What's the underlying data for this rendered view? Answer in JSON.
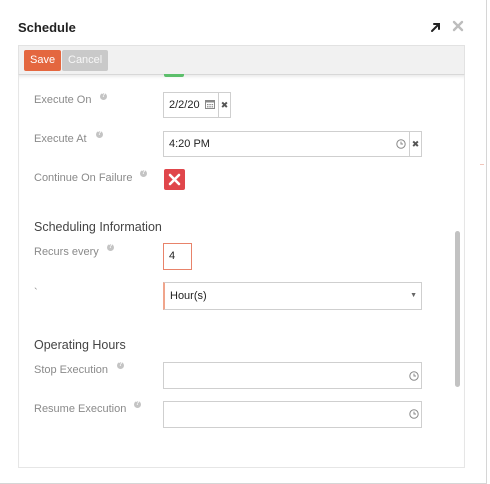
{
  "dialog": {
    "title": "Schedule",
    "expand_icon": "expand-arrow-icon",
    "close_icon": "close-icon"
  },
  "toolbar": {
    "save_label": "Save",
    "cancel_label": "Cancel",
    "save_color": "#e4673f",
    "cancel_color": "#c9c9c9"
  },
  "form": {
    "execute_on": {
      "label": "Execute On",
      "value": "2/2/20",
      "help": "?"
    },
    "execute_at": {
      "label": "Execute At",
      "value": "4:20 PM",
      "help": "?"
    },
    "continue_on_failure": {
      "label": "Continue On Failure",
      "checked": false,
      "help": "?"
    },
    "scheduling": {
      "title": "Scheduling Information",
      "recurs_every": {
        "label": "Recurs every",
        "value": "4",
        "help": "?"
      },
      "unit_label": "`",
      "unit": {
        "value": "Hour(s)"
      }
    },
    "operating_hours": {
      "title": "Operating Hours",
      "stop_execution": {
        "label": "Stop Execution",
        "value": "",
        "help": "?"
      },
      "resume_execution": {
        "label": "Resume Execution",
        "value": "",
        "help": "?"
      }
    }
  },
  "colors": {
    "accent": "#e4673f",
    "unchecked_red": "#e0464b",
    "success_green": "#5cbf6b"
  }
}
